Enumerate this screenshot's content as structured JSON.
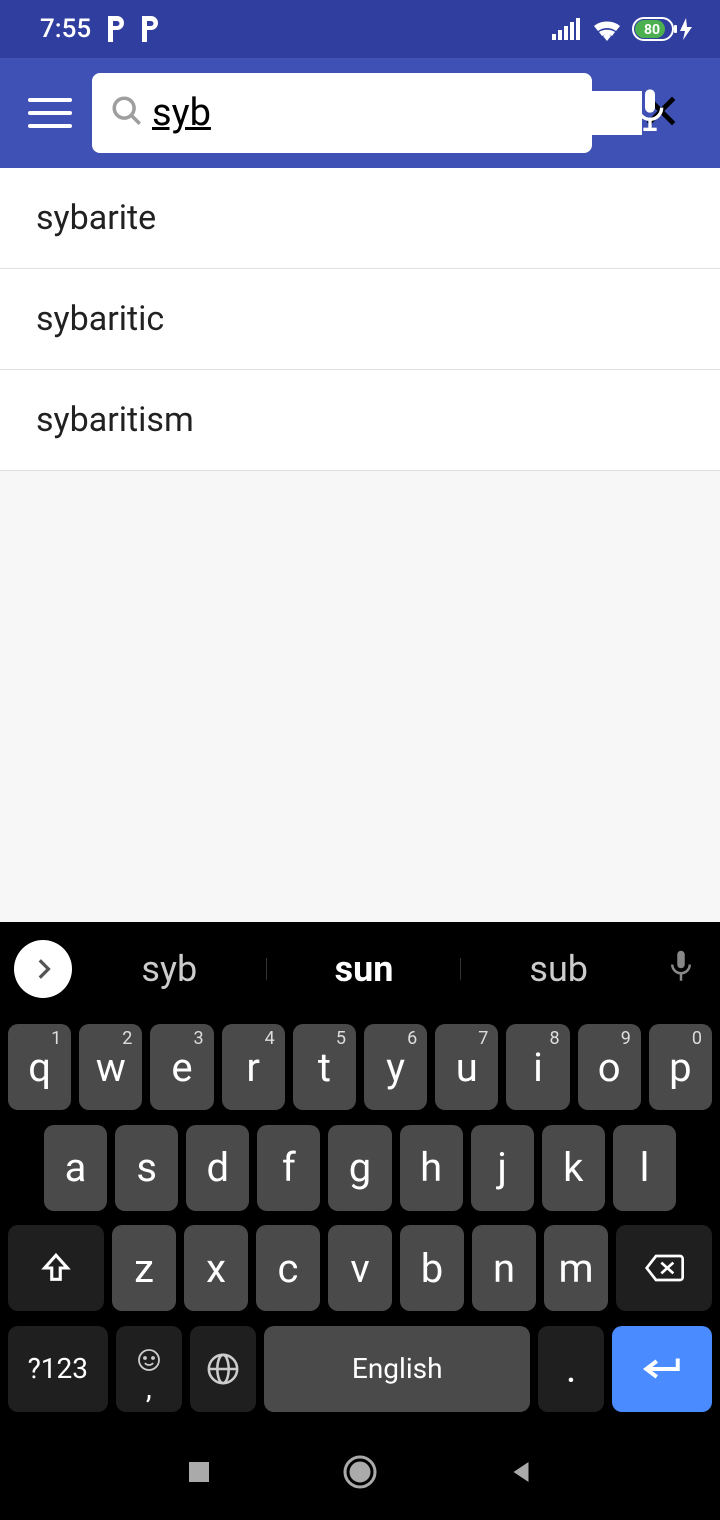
{
  "status": {
    "time": "7:55",
    "battery": "80"
  },
  "search": {
    "value": "syb"
  },
  "results": [
    {
      "label": "sybarite"
    },
    {
      "label": "sybaritic"
    },
    {
      "label": "sybaritism"
    }
  ],
  "keyboard": {
    "suggestions": [
      {
        "text": "syb",
        "primary": false
      },
      {
        "text": "sun",
        "primary": true
      },
      {
        "text": "sub",
        "primary": false
      }
    ],
    "row1": [
      {
        "k": "q",
        "s": "1"
      },
      {
        "k": "w",
        "s": "2"
      },
      {
        "k": "e",
        "s": "3"
      },
      {
        "k": "r",
        "s": "4"
      },
      {
        "k": "t",
        "s": "5"
      },
      {
        "k": "y",
        "s": "6"
      },
      {
        "k": "u",
        "s": "7"
      },
      {
        "k": "i",
        "s": "8"
      },
      {
        "k": "o",
        "s": "9"
      },
      {
        "k": "p",
        "s": "0"
      }
    ],
    "row2": [
      "a",
      "s",
      "d",
      "f",
      "g",
      "h",
      "j",
      "k",
      "l"
    ],
    "row3": [
      "z",
      "x",
      "c",
      "v",
      "b",
      "n",
      "m"
    ],
    "symKey": "?123",
    "spaceLabel": "English",
    "periodKey": "."
  }
}
